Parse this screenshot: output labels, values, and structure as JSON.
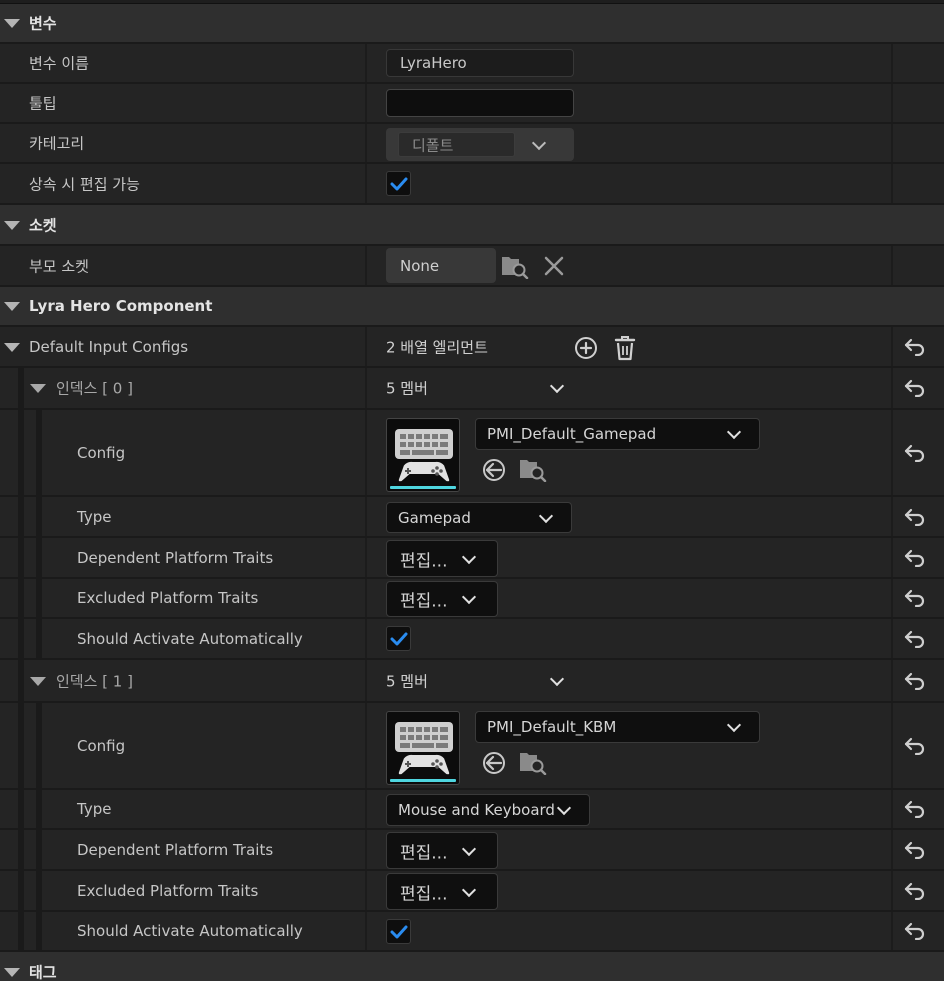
{
  "categories": {
    "variables": "변수",
    "socket": "소켓",
    "lyra_hero": "Lyra Hero Component",
    "tags": "태그"
  },
  "variable_props": {
    "name_label": "변수 이름",
    "name_value": "LyraHero",
    "tooltip_label": "툴팁",
    "tooltip_value": "",
    "category_label": "카테고리",
    "category_value": "디폴트",
    "editable_label": "상속 시 편집 가능",
    "editable_checked": true
  },
  "socket_props": {
    "parent_label": "부모 소켓",
    "parent_value": "None"
  },
  "input_configs": {
    "label": "Default Input Configs",
    "count_text": "2 배열 엘리먼트",
    "elements": [
      {
        "index_label": "인덱스 [ 0 ]",
        "members_text": "5 멤버",
        "config_label": "Config",
        "config_value": "PMI_Default_Gamepad",
        "type_label": "Type",
        "type_value": "Gamepad",
        "dependent_label": "Dependent Platform Traits",
        "dependent_value": "편집...",
        "excluded_label": "Excluded Platform Traits",
        "excluded_value": "편집...",
        "activate_label": "Should Activate Automatically",
        "activate_checked": true
      },
      {
        "index_label": "인덱스 [ 1 ]",
        "members_text": "5 멤버",
        "config_label": "Config",
        "config_value": "PMI_Default_KBM",
        "type_label": "Type",
        "type_value": "Mouse and Keyboard",
        "dependent_label": "Dependent Platform Traits",
        "dependent_value": "편집...",
        "excluded_label": "Excluded Platform Traits",
        "excluded_value": "편집...",
        "activate_label": "Should Activate Automatically",
        "activate_checked": true
      }
    ]
  },
  "colors": {
    "checkmark": "#2a8cf0",
    "thumbnail_accent": "#4fd6e0",
    "category_bg": "#2f2f2f",
    "row_bg": "#242424"
  },
  "icons": {
    "reset": "reset-arrow-icon",
    "add": "add-element-icon",
    "trash": "trash-icon",
    "browse": "browse-asset-icon",
    "use_selected": "use-selected-icon",
    "clear": "clear-icon",
    "thumbnail": "keyboard-gamepad-icon"
  }
}
